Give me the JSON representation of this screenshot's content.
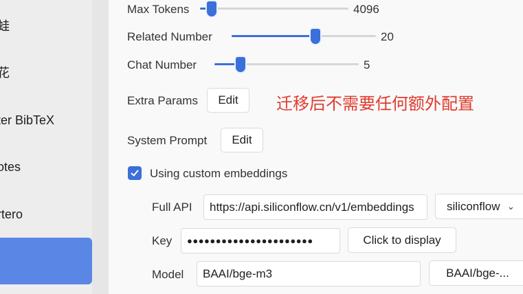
{
  "sidebar": {
    "items": [
      {
        "label": "蛙"
      },
      {
        "label": "花"
      },
      {
        "label": "ter BibTeX"
      },
      {
        "label": "otes"
      },
      {
        "label": "rtero"
      },
      {
        "label": ""
      }
    ]
  },
  "settings": {
    "max_tokens": {
      "label": "Max Tokens",
      "value": "4096",
      "level": 0.08
    },
    "related_number": {
      "label": "Related Number",
      "value": "20",
      "level": 0.58
    },
    "chat_number": {
      "label": "Chat Number",
      "value": "5",
      "level": 0.18
    },
    "extra_params": {
      "label": "Extra Params",
      "button": "Edit"
    },
    "system_prompt": {
      "label": "System Prompt",
      "button": "Edit"
    },
    "note": "迁移后不需要任何额外配置",
    "custom_embeddings": {
      "label": "Using custom embeddings",
      "checked": true
    },
    "full_api": {
      "label": "Full API",
      "value": "https://api.siliconflow.cn/v1/embeddings",
      "provider": "siliconflow"
    },
    "key": {
      "label": "Key",
      "value": "●●●●●●●●●●●●●●●●●●●●●●",
      "reveal_button": "Click to display"
    },
    "model": {
      "label": "Model",
      "value": "BAAI/bge-m3",
      "preset": "BAAI/bge-..."
    }
  },
  "colors": {
    "accent": "#3b6fd9",
    "note": "#e03a2c",
    "sidebar_active": "#5a86e6"
  }
}
